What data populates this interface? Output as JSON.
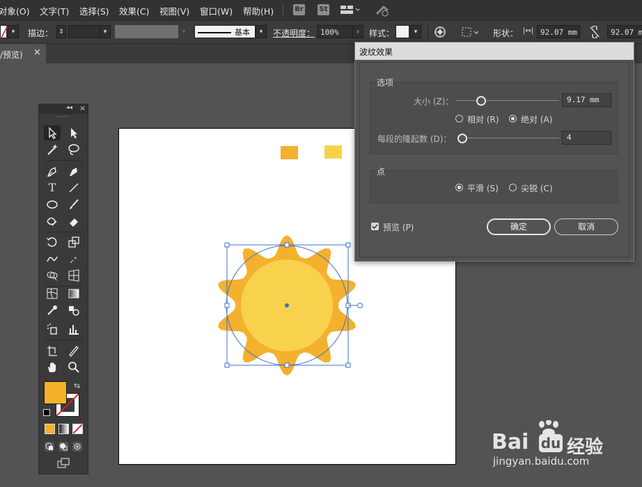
{
  "menubar": {
    "items": [
      "对象(O)",
      "文字(T)",
      "选择(S)",
      "效果(C)",
      "视图(V)",
      "窗口(W)",
      "帮助(H)"
    ],
    "badges": [
      "Br",
      "St"
    ]
  },
  "control_bar": {
    "stroke_label": "描边：",
    "stroke_style": "基本",
    "opacity_label": "不透明度：",
    "opacity_value": "100%",
    "style_label": "样式：",
    "shape_label": "形状：",
    "width_value": "92.07 mm",
    "height_value": "92.07 m"
  },
  "tab": {
    "label": "/预览)",
    "close": "×"
  },
  "tools_panel": {
    "collapse": "◂◂",
    "close": "×"
  },
  "dialog": {
    "title": "波纹效果",
    "options_group": "选项",
    "size_label": "大小 (Z)：",
    "size_value": "9.17 mm",
    "size_slider": 0.24,
    "relative_label": "相对 (R)",
    "absolute_label": "绝对 (A)",
    "absolute_selected": true,
    "ridges_label": "每段的隆起数 (D)：",
    "ridges_value": "4",
    "ridges_slider": 0.04,
    "points_group": "点",
    "smooth_label": "平滑 (S)",
    "corner_label": "尖锐 (C)",
    "smooth_selected": true,
    "preview_label": "预览 (P)",
    "preview_checked": true,
    "ok_label": "确定",
    "cancel_label": "取消"
  },
  "swatches": {
    "fill_color": "#f5b12a",
    "stroke_color": "none"
  },
  "canvas": {
    "sun_outer": "#f3b12e",
    "sun_inner": "#f8d24d",
    "swatch_a": "#f3b12e",
    "swatch_b": "#f8d24d",
    "selection": "#3d6fd1"
  },
  "watermark": {
    "brand": "Bai",
    "brand2": "du",
    "suffix": "经验",
    "url": "jingyan.baidu.com"
  }
}
